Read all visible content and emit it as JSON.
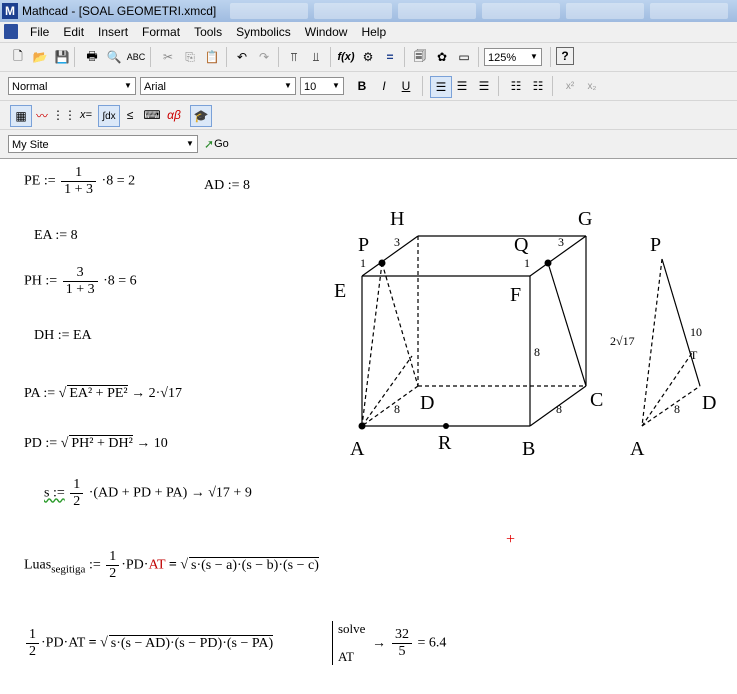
{
  "window": {
    "app_icon": "M",
    "title": "Mathcad - [SOAL GEOMETRI.xmcd]"
  },
  "menu": [
    "File",
    "Edit",
    "Insert",
    "Format",
    "Tools",
    "Symbolics",
    "Window",
    "Help"
  ],
  "toolbar": {
    "zoom": "125%",
    "style": "Normal",
    "font": "Arial",
    "font_size": "10",
    "bold": "B",
    "italic": "I",
    "underline": "U",
    "fx": "f(x)",
    "site": "My Site",
    "go": "Go"
  },
  "worksheet": {
    "pe": {
      "lhs": "PE :=",
      "num": "1",
      "den": "1 + 3",
      "rest": "·8 = 2"
    },
    "ad": "AD := 8",
    "ea": "EA := 8",
    "ph": {
      "lhs": "PH :=",
      "num": "3",
      "den": "1 + 3",
      "rest": "·8 = 6"
    },
    "dh": "DH := EA",
    "pa": {
      "lhs": "PA :=",
      "rad": "EA² + PE²",
      "res": "→ 2·√17"
    },
    "pd": {
      "lhs": "PD :=",
      "rad": "PH² + DH²",
      "res": "→ 10"
    },
    "s": {
      "lhs": "s :=",
      "num": "1",
      "den": "2",
      "body": "·(AD + PD + PA) → √17 + 9"
    },
    "luas": {
      "lhs": "Luas",
      "sub": "segitiga",
      "assign": ":=",
      "num": "1",
      "den": "2",
      "pd": "·PD·",
      "at": "AT",
      "eq": "=",
      "rad": "s·(s − a)·(s − b)·(s − c)"
    },
    "solve": {
      "num": "1",
      "den": "2",
      "mid": "·PD·AT",
      "eq": "=",
      "rad": "s·(s − AD)·(s − PD)·(s − PA)",
      "kw": "solve",
      "var": "AT",
      "arrow": "→",
      "rnum": "32",
      "rden": "5",
      "res": "= 6.4"
    }
  },
  "cube_labels": {
    "H": "H",
    "G": "G",
    "P": "P",
    "Q": "Q",
    "E": "E",
    "F": "F",
    "D": "D",
    "C": "C",
    "A": "A",
    "R": "R",
    "B": "B",
    "p3": "3",
    "q3": "3",
    "p1": "1",
    "q1": "1",
    "e8": "8",
    "f8": "8",
    "c8": "8"
  },
  "tri_labels": {
    "P": "P",
    "A": "A",
    "D": "D",
    "T": "T",
    "pa": "2√17",
    "pt": "10",
    "ad": "8"
  }
}
